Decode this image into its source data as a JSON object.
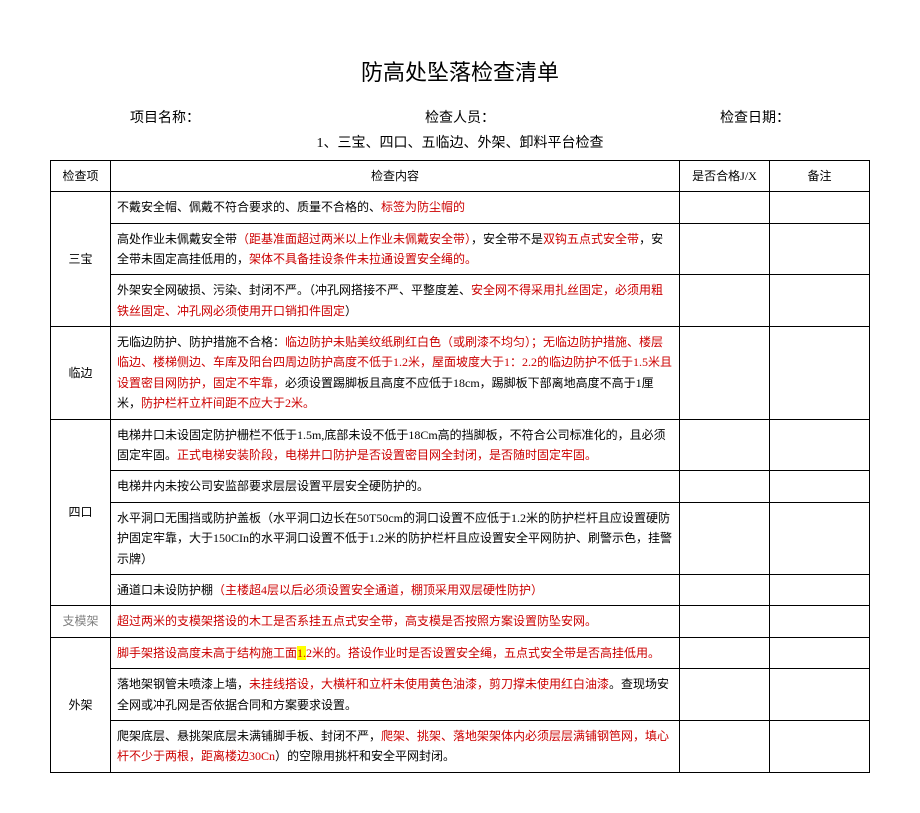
{
  "title": "防高处坠落检查清单",
  "info": {
    "project_label": "项目名称：",
    "inspector_label": "检查人员：",
    "date_label": "检查日期："
  },
  "subtitle": "1、三宝、四口、五临边、外架、卸料平台检查",
  "headers": {
    "item": "检查项",
    "content": "检查内容",
    "pass": "是否合格J/X",
    "note": "备注"
  },
  "t": {
    "sanbao": "三宝",
    "sb1a": "不戴安全帽、佩戴不符合要求的、质量不合格的、",
    "sb1b": "标签为防尘帽的",
    "sb2a": "高处作业未佩戴安全带",
    "sb2b": "（距基准面超过两米以上作业未佩戴安全带）",
    "sb2c": "，安全带不是",
    "sb2d": "双钩五点式安全带",
    "sb2e": "，安全带未固定高挂低用的，",
    "sb2f": "架体不具备挂设条件未拉通设置安全绳的。",
    "sb3a": "外架安全网破损、污染、封闭不严。（冲孔网搭接不严、平整度差、",
    "sb3b": "安全网不得采用扎丝固定，必须用粗铁丝固定、冲孔网必须使用开口销扣件固定",
    "sb3c": "）",
    "linbian": "临边",
    "lb1a": "无临边防护、防护措施不合格：",
    "lb1b": "临边防护未贴美纹纸刷红白色（或刷漆不均匀）；无临边防护措施、楼层临边、楼梯侧边、车库及阳台四周边防护高度不低于1.2米，屋面坡度大于1：2.2的临边防护不低于1.5米且设置密目网防护，固定不牢靠，",
    "lb1c": "必须设置踢脚板且高度不应低于18cm，踢脚板下部离地高度不高于1厘米，",
    "lb1d": "防护栏杆立杆间距不应大于2米。",
    "sikou": "四口",
    "sk1a": "电梯井口未设固定防护栅栏不低于1.5m,底部未设不低于18Cm高的挡脚板，不符合公司标准化的，且必须固定牢固。",
    "sk1b": "正式电梯安装阶段，电梯井口防护是否设置密目网全封闭，是否随时固定牢固。",
    "sk2": "电梯井内未按公司安监部要求层层设置平层安全硬防护的。",
    "sk3": "水平洞口无围挡或防护盖板（水平洞口边长在50T50cm的洞口设置不应低于1.2米的防护栏杆且应设置硬防护固定牢靠，大于150CIn的水平洞口设置不低于1.2米的防护栏杆且应设置安全平网防护、刷警示色，挂警示牌）",
    "sk4a": "通道口未设防护棚",
    "sk4b": "（主楼超4层以后必须设置安全通道，棚顶采用双层硬性防护）",
    "zmj": "支模架",
    "zmj1": "超过两米的支模架搭设的木工是否系挂五点式安全带，高支模是否按照方案设置防坠安网。",
    "waijia": "外架",
    "wj1a": "脚手架搭设高度未高于结构施工面",
    "wj1b": "1.",
    "wj1c": "2米的。",
    "wj1d": "搭设作业时是否设置安全绳，五点式安全带是否高挂低用。",
    "wj2a": "落地架钢管未喷漆上墙，",
    "wj2b": "未挂线搭设，大横杆和立杆未使用黄色油漆，剪刀撑未使用红白油漆",
    "wj2c": "。查现场安全网或冲孔网是否依据合同和方案要求设置。",
    "wj3a": "爬架底层、悬挑架底层未满铺脚手板、封闭不严，",
    "wj3b": "爬架、挑架、落地架架体内必须层层满铺钢笆网，填心杆不少于两根，距离楼边30Cn",
    "wj3c": "）的空隙用挑杆和安全平网封闭。"
  }
}
